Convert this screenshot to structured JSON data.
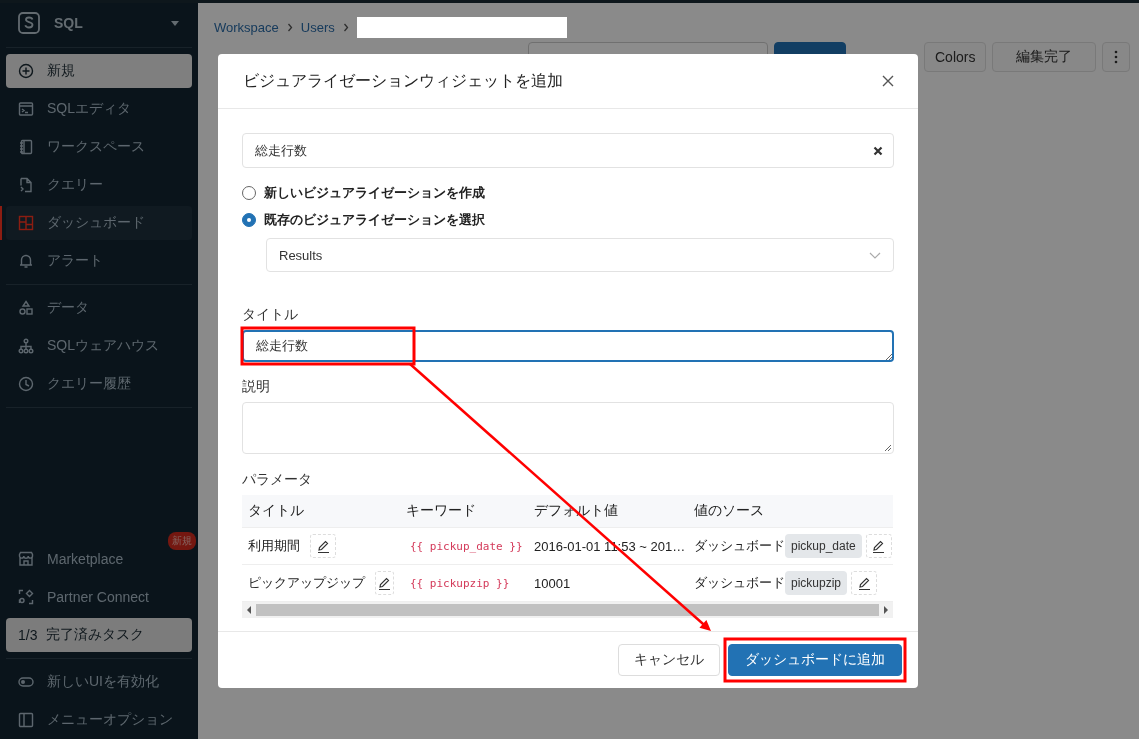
{
  "sidebar": {
    "product": {
      "label": "SQL"
    },
    "new_button": {
      "label": "新規"
    },
    "nav_groups": [
      [
        {
          "label": "SQLエディタ",
          "selected": false
        },
        {
          "label": "ワークスペース",
          "selected": false
        },
        {
          "label": "クエリー",
          "selected": false
        },
        {
          "label": "ダッシュボード",
          "selected": true
        },
        {
          "label": "アラート",
          "selected": false
        }
      ],
      [
        {
          "label": "データ",
          "selected": false
        },
        {
          "label": "SQLウェアハウス",
          "selected": false
        },
        {
          "label": "クエリー履歴",
          "selected": false
        }
      ]
    ],
    "bottom_items": [
      {
        "label": "Marketplace",
        "badge": "新規"
      },
      {
        "label": "Partner Connect"
      }
    ],
    "task_progress": {
      "count": "1/3",
      "label": "完了済みタスク"
    },
    "footer_items": [
      {
        "label": "新しいUIを有効化"
      },
      {
        "label": "メニューオプション"
      }
    ]
  },
  "header": {
    "breadcrumbs": [
      "Workspace",
      "Users"
    ],
    "buttons": [
      {
        "kind": "primary"
      },
      {
        "kind": "default",
        "label": "Colors"
      },
      {
        "kind": "default",
        "label": "編集完了"
      },
      {
        "kind": "more"
      }
    ]
  },
  "dialog": {
    "title": "ビジュアライゼーションウィジェットを追加",
    "search_field": {
      "value": "総走行数"
    },
    "options": [
      {
        "label": "新しいビジュアライゼーションを作成",
        "selected": false
      },
      {
        "label": "既存のビジュアライゼーションを選択",
        "selected": true
      }
    ],
    "visualization_select": {
      "value": "Results"
    },
    "title_field": {
      "label": "タイトル",
      "value": "総走行数",
      "focused": true
    },
    "description_field": {
      "label": "説明"
    },
    "parameters": {
      "label": "パラメータ",
      "columns": [
        "タイトル",
        "キーワード",
        "デフォルト値",
        "値のソース"
      ],
      "rows": [
        {
          "title": "利用期間",
          "keyword": "{{ pickup_date }}",
          "default_value": "2016-01-01 11:53 ~ 201…",
          "source": "ダッシュボード",
          "source_parameter": "pickup_date"
        },
        {
          "title": "ピックアップジップ",
          "keyword": "{{ pickupzip }}",
          "default_value": "10001",
          "source": "ダッシュボード",
          "source_parameter": "pickupzip"
        }
      ]
    },
    "buttons": [
      {
        "kind": "default",
        "label": "キャンセル"
      },
      {
        "kind": "primary",
        "label": "ダッシュボードに追加"
      }
    ]
  }
}
